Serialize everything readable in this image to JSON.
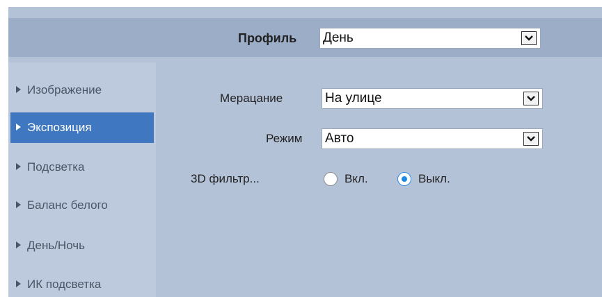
{
  "profile": {
    "label": "Профиль",
    "value": "День"
  },
  "sidebar": {
    "items": [
      {
        "label": "Изображение",
        "active": false
      },
      {
        "label": "Экспозиция",
        "active": true
      },
      {
        "label": "Подсветка",
        "active": false
      },
      {
        "label": "Баланс белого",
        "active": false
      },
      {
        "label": "День/Ночь",
        "active": false
      },
      {
        "label": "ИК подсветка",
        "active": false
      }
    ]
  },
  "settings": {
    "metering": {
      "label": "Мерацание",
      "value": "На улице"
    },
    "mode": {
      "label": "Режим",
      "value": "Авто"
    },
    "filter3d": {
      "label": "3D фильтр...",
      "options": [
        {
          "label": "Вкл.",
          "selected": false
        },
        {
          "label": "Выкл.",
          "selected": true
        }
      ]
    }
  },
  "colors": {
    "accent": "#3f78c1",
    "panel": "#b4c2d8",
    "header": "#9cadc7",
    "radio_selected": "#1e88e5"
  }
}
